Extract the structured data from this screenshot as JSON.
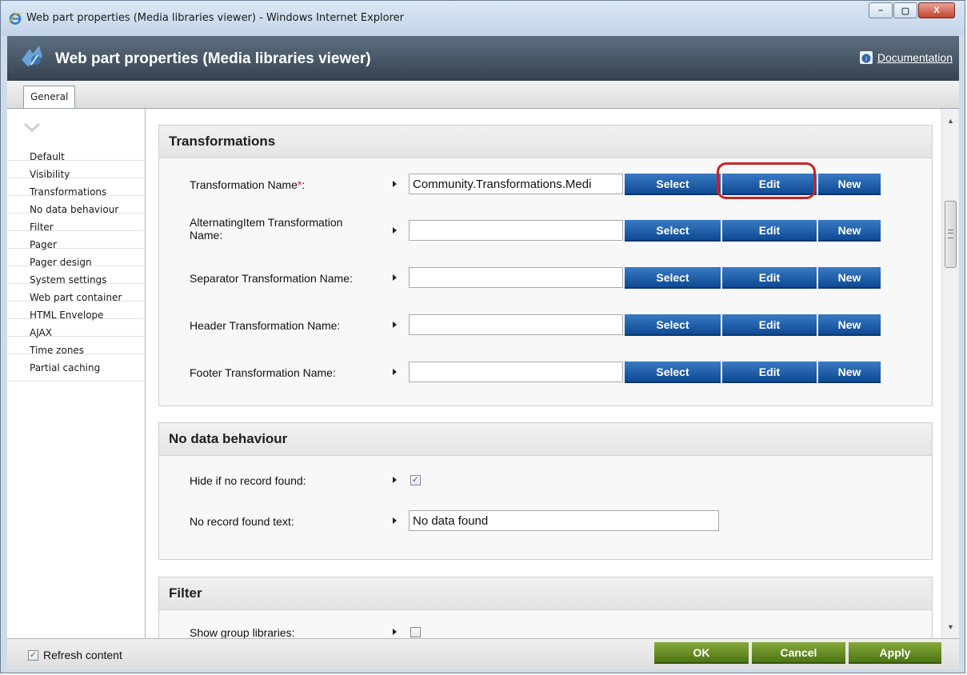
{
  "window": {
    "title": "Web part properties (Media libraries viewer) - Windows Internet Explorer",
    "buttons": {
      "minimize": "–",
      "maximize": "▢",
      "close": "X"
    }
  },
  "header": {
    "title": "Web part properties (Media libraries viewer)",
    "documentation": "Documentation"
  },
  "tabs": [
    {
      "label": "General"
    }
  ],
  "sidebar": {
    "items": [
      {
        "label": "Default"
      },
      {
        "label": "Visibility"
      },
      {
        "label": "Transformations"
      },
      {
        "label": "No data behaviour"
      },
      {
        "label": "Filter"
      },
      {
        "label": "Pager"
      },
      {
        "label": "Pager design"
      },
      {
        "label": "System settings"
      },
      {
        "label": "Web part container"
      },
      {
        "label": "HTML Envelope"
      },
      {
        "label": "AJAX"
      },
      {
        "label": "Time zones"
      },
      {
        "label": "Partial caching"
      }
    ]
  },
  "buttons": {
    "select": "Select",
    "edit": "Edit",
    "new": "New"
  },
  "transformations": {
    "title": "Transformations",
    "rows": [
      {
        "label": "Transformation Name",
        "required": "*",
        "suffix": ":",
        "value": "Community.Transformations.Medi"
      },
      {
        "label": "AlternatingItem Transformation Name:",
        "value": ""
      },
      {
        "label": "Separator Transformation Name:",
        "value": ""
      },
      {
        "label": "Header Transformation Name:",
        "value": ""
      },
      {
        "label": "Footer Transformation Name:",
        "value": ""
      }
    ]
  },
  "no_data": {
    "title": "No data behaviour",
    "hide_label": "Hide if no record found:",
    "hide_checked": "✓",
    "text_label": "No record found text:",
    "text_value": "No data found"
  },
  "filter": {
    "title": "Filter",
    "show_group_label": "Show group libraries:"
  },
  "footer": {
    "refresh_label": "Refresh content",
    "refresh_checked": "✓",
    "ok": "OK",
    "cancel": "Cancel",
    "apply": "Apply"
  }
}
